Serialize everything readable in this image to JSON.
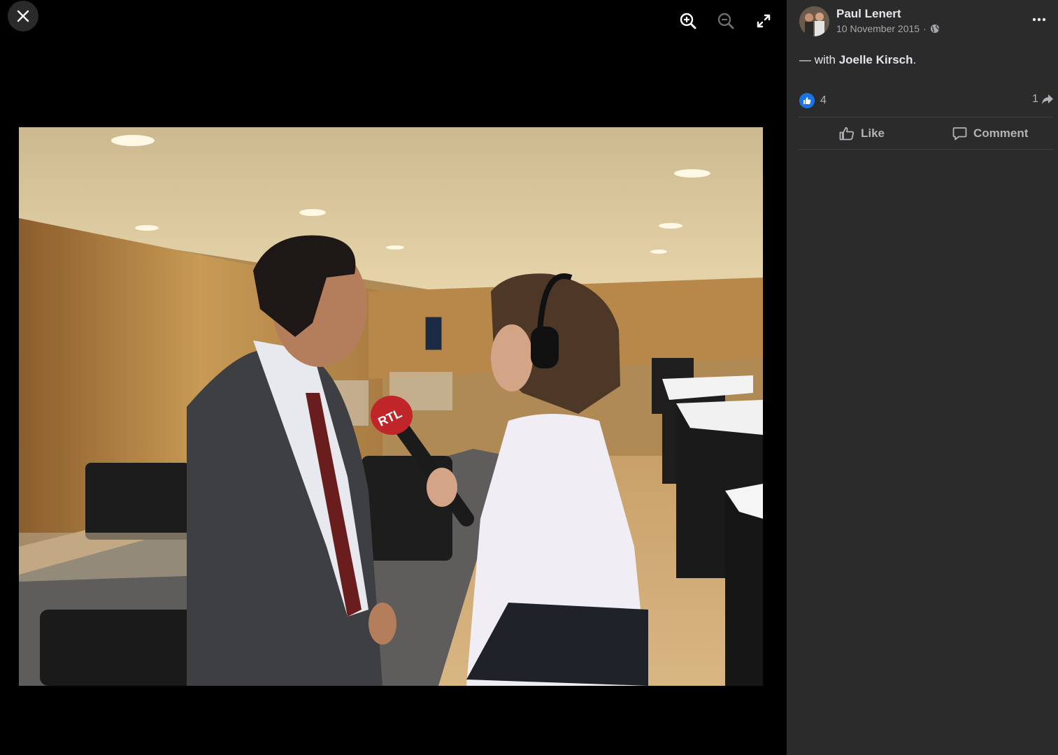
{
  "viewer": {
    "icons": {
      "close": "close-icon",
      "zoom_in": "zoom-in-icon",
      "zoom_out": "zoom-out-icon",
      "fullscreen": "fullscreen-icon"
    },
    "photo": {
      "mic_label": "RTL"
    }
  },
  "post": {
    "author": "Paul Lenert",
    "date": "10 November 2015",
    "date_separator": "·",
    "privacy_icon": "globe-icon",
    "caption_prefix": "— with ",
    "caption_tag": "Joelle Kirsch",
    "caption_suffix": ".",
    "reactions_count": "4",
    "shares_count": "1",
    "like_label": "Like",
    "comment_label": "Comment"
  },
  "colors": {
    "viewer_bg": "#000000",
    "panel_bg": "#2b2b2b",
    "like_blue": "#1b74e4",
    "text_primary": "#e4e6eb",
    "text_secondary": "#b0b3b8"
  }
}
